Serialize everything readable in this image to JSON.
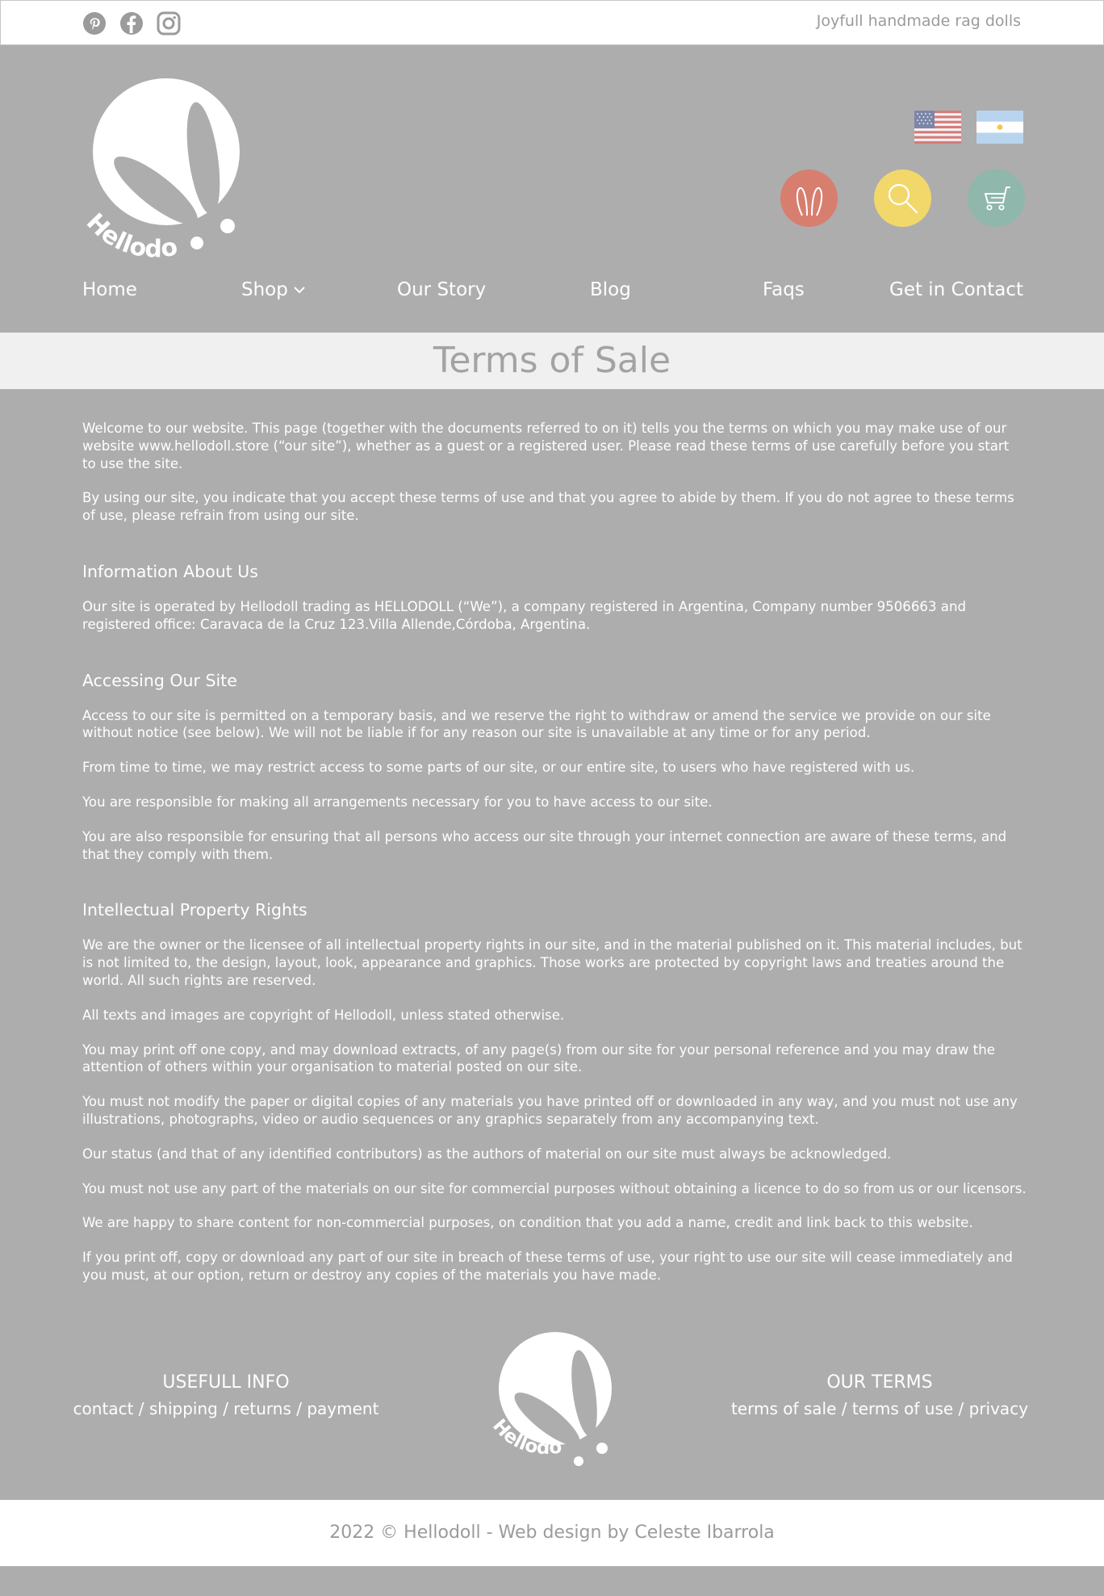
{
  "topbar": {
    "social_icons": [
      "pinterest-icon",
      "facebook-icon",
      "instagram-icon"
    ],
    "tagline": "Joyfull handmade rag dolls"
  },
  "header": {
    "logo_text": "Hellodoll",
    "flags": [
      "usa-flag-icon",
      "argentina-flag-icon"
    ],
    "actions": [
      {
        "icon": "bunny-ears-icon",
        "color": "#d77e6f"
      },
      {
        "icon": "search-icon",
        "color": "#f2d86a"
      },
      {
        "icon": "cart-icon",
        "color": "#8fb7ab"
      }
    ]
  },
  "nav": {
    "items": [
      "Home",
      "Shop",
      "Our Story",
      "Blog",
      "Faqs",
      "Get in Contact"
    ]
  },
  "page": {
    "title": "Terms of Sale"
  },
  "content": {
    "intro": [
      "Welcome to our website. This page (together with the documents referred to on it) tells you the terms on which you may make use of our website www.hellodoll.store (“our site”), whether as a guest or a registered user. Please read these terms of use carefully before you start to use the site.",
      "By using our site, you indicate that you accept these terms of use and that you agree to abide by them. If you do not agree to these terms of use, please refrain from using our site."
    ],
    "sections": [
      {
        "heading": "Information About Us",
        "paragraphs": [
          "Our site is operated by Hellodoll trading as HELLODOLL (“We”), a company registered in Argentina, Company number 9506663 and registered office: Caravaca de la Cruz 123.Villa Allende,Córdoba, Argentina."
        ]
      },
      {
        "heading": "Accessing Our Site",
        "paragraphs": [
          "Access to our site is permitted on a temporary basis, and we reserve the right to withdraw or amend the service we provide on our site without notice (see below). We will not be liable if for any reason our site is unavailable at any time or for any period.",
          "From time to time, we may restrict access to some parts of our site, or our entire site, to users who have registered with us.",
          "You are responsible for making all arrangements necessary for you to have access to our site.",
          "You are also responsible for ensuring that all persons who access our site through your internet connection are aware of these terms, and that they comply with them."
        ]
      },
      {
        "heading": "Intellectual Property Rights",
        "paragraphs": [
          "We are the owner or the licensee of all intellectual property rights in our site, and in the material published on it.  This material includes, but is not limited to, the design, layout, look, appearance and graphics. Those works are protected by copyright laws and treaties around the world. All such rights are reserved.",
          "All texts and images are copyright of Hellodoll, unless stated otherwise.",
          "You may print off one copy, and may download extracts, of any page(s) from our site for your personal reference and you may draw the attention of others within your organisation to material posted on our site.",
          "You must not modify the paper or digital copies of any materials you have printed off or downloaded in any way, and you must not use any illustrations, photographs, video or audio sequences or any graphics separately from any accompanying text.",
          "Our status (and that of any identified contributors) as the authors of material on our site must always be acknowledged.",
          "You must not use any part of the materials on our site for commercial purposes without obtaining a licence to do so from us or our licensors.",
          "We are happy to share content for non-commercial purposes, on condition that you add a name, credit and link back to this website.",
          "If you print off, copy or download any part of our site in breach of these terms of use, your right to use our site will cease immediately and you must, at our option, return or destroy any copies of the materials you have made."
        ]
      }
    ]
  },
  "footer": {
    "left": {
      "title": "USEFULL INFO",
      "links": [
        "contact",
        "shipping",
        "returns",
        "payment"
      ],
      "separator": " / "
    },
    "right": {
      "title": "OUR TERMS",
      "links": [
        "terms of sale",
        "terms of use",
        "privacy"
      ],
      "separator": " / "
    },
    "logo_text": "Hellodoll",
    "copyright": "2022 © Hellodoll - Web design by Celeste Ibarrola"
  }
}
